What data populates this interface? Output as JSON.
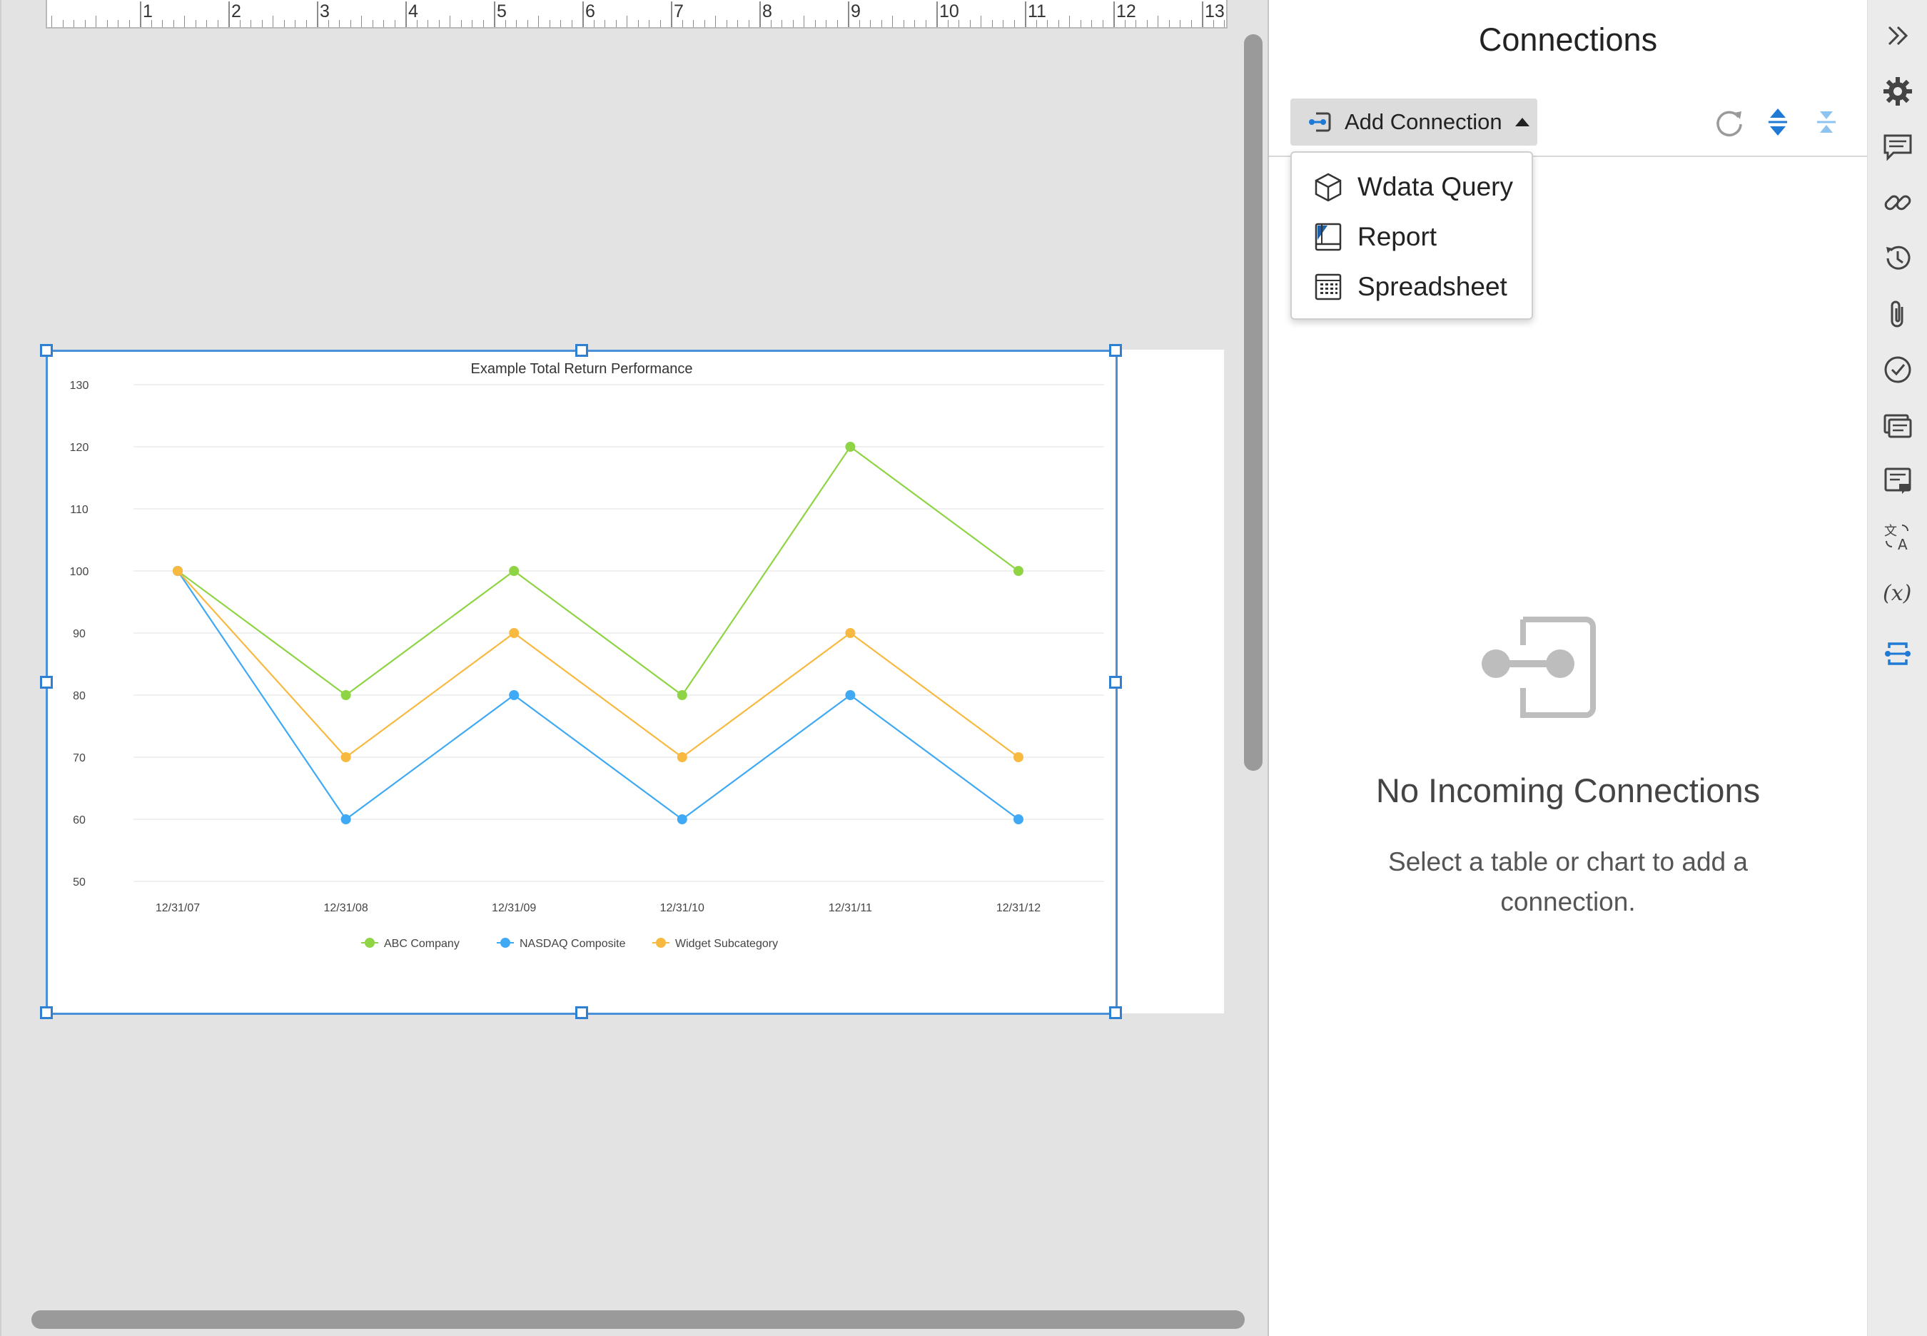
{
  "ruler": {
    "numbers": [
      "1",
      "2",
      "3",
      "4",
      "5",
      "6",
      "7",
      "8",
      "9",
      "10",
      "11",
      "12",
      "13"
    ]
  },
  "chart_data": {
    "type": "line",
    "title": "Example Total Return Performance",
    "categories": [
      "12/31/07",
      "12/31/08",
      "12/31/09",
      "12/31/10",
      "12/31/11",
      "12/31/12"
    ],
    "yticks": [
      "50",
      "60",
      "70",
      "80",
      "90",
      "100",
      "110",
      "120",
      "130"
    ],
    "ylim": [
      50,
      130
    ],
    "grid": true,
    "legend_position": "bottom",
    "series": [
      {
        "name": "ABC Company",
        "color": "#8ed444",
        "values": [
          100,
          80,
          100,
          80,
          120,
          100
        ]
      },
      {
        "name": "NASDAQ Composite",
        "color": "#3fa9f5",
        "values": [
          100,
          60,
          80,
          60,
          80,
          60
        ]
      },
      {
        "name": "Widget Subcategory",
        "color": "#f8b940",
        "values": [
          100,
          70,
          90,
          70,
          90,
          70
        ]
      }
    ]
  },
  "panel": {
    "title": "Connections",
    "add_button_label": "Add Connection",
    "dropdown_items": [
      {
        "label": "Wdata Query",
        "icon": "cube-icon"
      },
      {
        "label": "Report",
        "icon": "report-icon"
      },
      {
        "label": "Spreadsheet",
        "icon": "spreadsheet-icon"
      }
    ],
    "toolbar_icons": [
      "refresh-icon",
      "expand-all-icon",
      "collapse-all-icon"
    ],
    "empty_state": {
      "title": "No Incoming Connections",
      "message_line1": "Select a table or chart to add a",
      "message_line2": "connection."
    }
  },
  "rail": {
    "icons": [
      "collapse-panel-icon",
      "settings-icon",
      "comments-icon",
      "link-icon",
      "history-icon",
      "attachment-icon",
      "check-icon",
      "review-icon",
      "notes-icon",
      "translate-icon",
      "variable-icon",
      "connections-icon"
    ],
    "active": "connections-icon",
    "accent": "#1f7ad6"
  }
}
